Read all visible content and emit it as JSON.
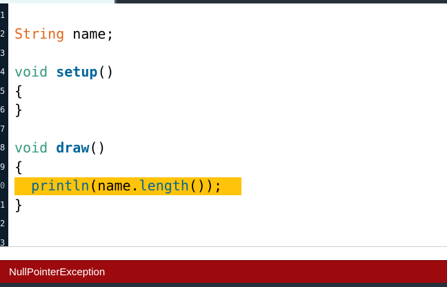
{
  "colors": {
    "type_keyword": "#e2661a",
    "void_keyword": "#33997e",
    "function": "#006699",
    "line_highlight": "#ffc30a",
    "gutter": "#0c1c2a",
    "error_bar": "#9d0a0e"
  },
  "gutter": {
    "numbers": [
      "1",
      "2",
      "3",
      "4",
      "5",
      "6",
      "7",
      "8",
      "9",
      "0",
      "1",
      "2",
      "3"
    ],
    "highlighted_line": "0"
  },
  "code": {
    "line2": {
      "type": "String",
      "rest": " name;"
    },
    "line4": {
      "keyword": "void",
      "space": " ",
      "name": "setup",
      "rest": "()"
    },
    "line5": {
      "text": "{"
    },
    "line6": {
      "text": "}"
    },
    "line8": {
      "keyword": "void",
      "space": " ",
      "name": "draw",
      "rest": "()"
    },
    "line9": {
      "text": "{"
    },
    "line10": {
      "indent": "  ",
      "call": "println",
      "open": "(name.",
      "method": "length",
      "close": "());"
    },
    "line11": {
      "text": "}"
    }
  },
  "status": {
    "message": "NullPointerException"
  }
}
